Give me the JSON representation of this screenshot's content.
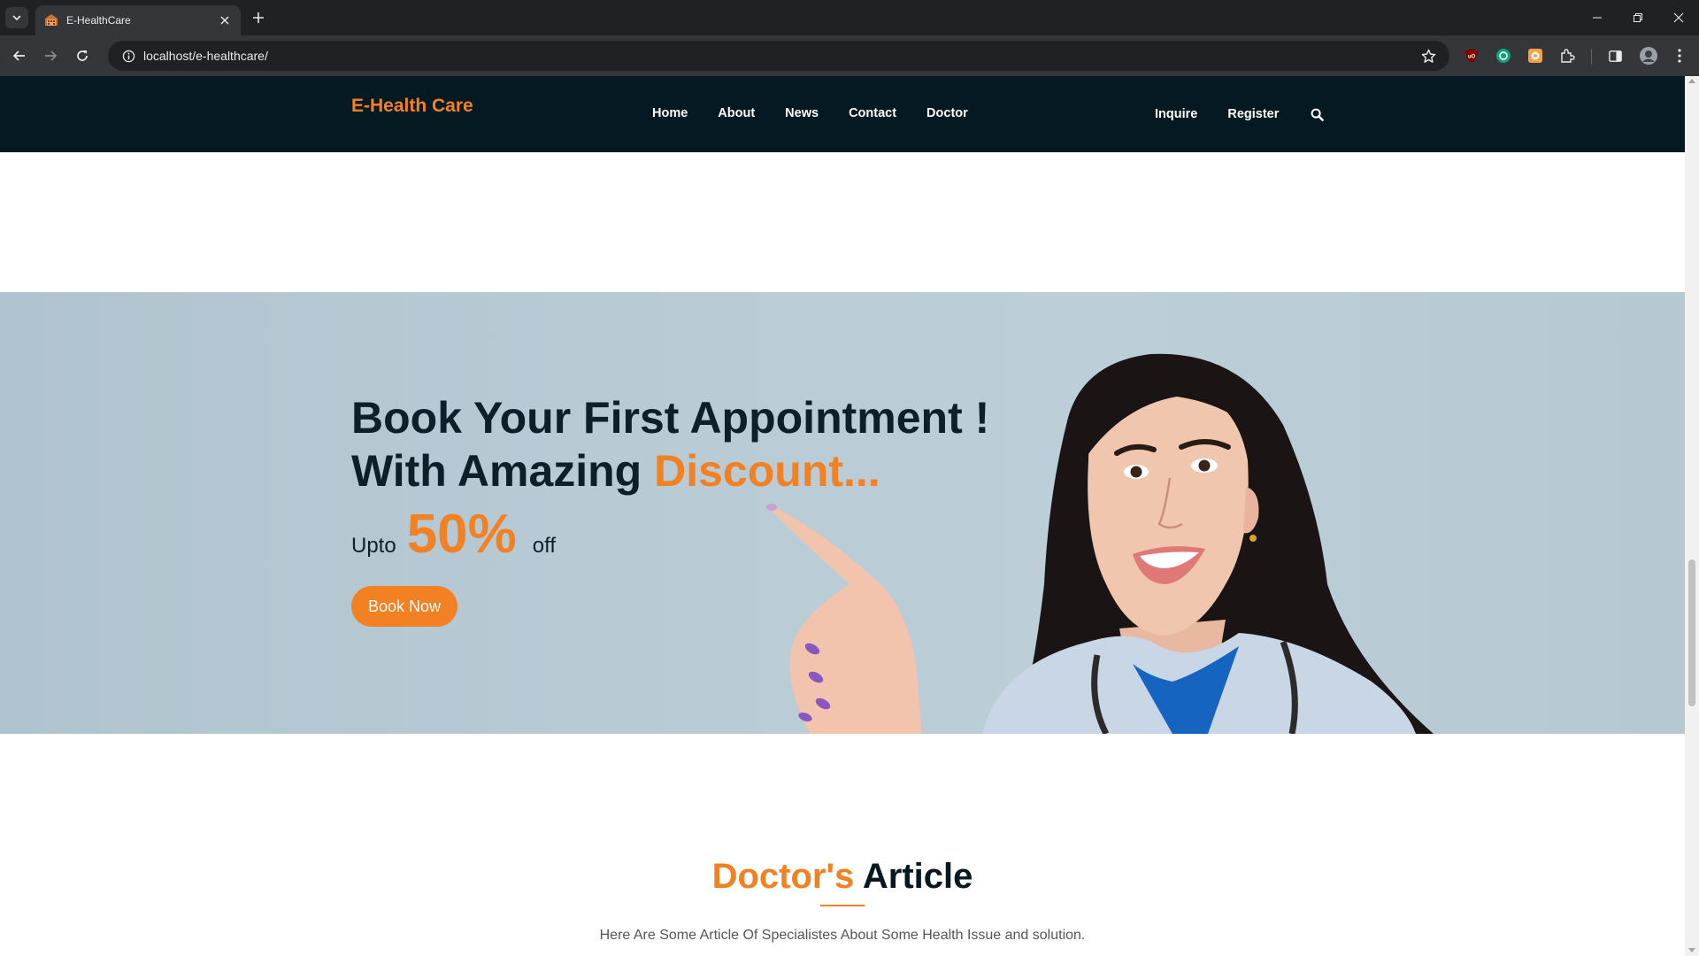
{
  "browser": {
    "tab_title": "E-HealthCare",
    "url": "localhost/e-healthcare/"
  },
  "site": {
    "logo": "E-Health Care",
    "nav": [
      "Home",
      "About",
      "News",
      "Contact",
      "Doctor"
    ],
    "right_nav": [
      "Inquire",
      "Register"
    ]
  },
  "hero": {
    "title_line1": "Book Your First Appointment !",
    "title_line2_lead": "With Amazing ",
    "title_line2_accent": "Discount...",
    "offer_pre": "Upto",
    "offer_value": "50%",
    "offer_post": "off",
    "cta_label": "Book Now"
  },
  "articles": {
    "title_accent": "Doctor's",
    "title_rest": " Article",
    "subtitle": "Here Are Some Article Of Specialistes About Some Health Issue and solution."
  },
  "colors": {
    "accent": "#f28123",
    "header_bg": "#051922",
    "hero_bg": "#b8cad4",
    "dark_text": "#0f1f2a"
  },
  "icons": [
    "tab-search-icon",
    "favicon-icon",
    "close-icon",
    "plus-icon",
    "back-icon",
    "forward-icon",
    "reload-icon",
    "info-icon",
    "star-icon",
    "ublock-icon",
    "chatgpt-icon",
    "extension-orange-icon",
    "puzzle-icon",
    "sidepanel-icon",
    "profile-icon",
    "kebab-menu-icon",
    "search-icon"
  ]
}
